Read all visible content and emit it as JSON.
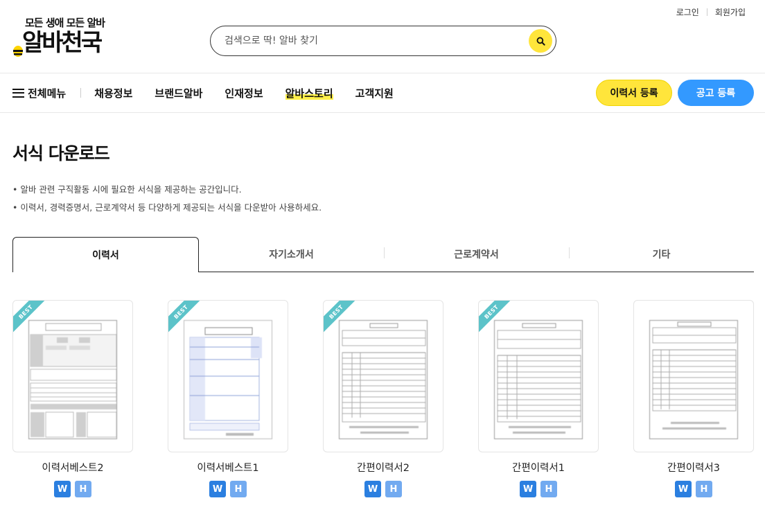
{
  "header": {
    "links": {
      "login": "로그인",
      "signup": "회원가입"
    },
    "logo": {
      "slogan": "모든 생애 모든 알바",
      "name": "알바천국"
    },
    "search": {
      "placeholder": "검색으로 딱! 알바 찾기"
    }
  },
  "nav": {
    "menu_label": "전체메뉴",
    "items": [
      "채용정보",
      "브랜드알바",
      "인재정보",
      "알바스토리",
      "고객지원"
    ],
    "resume_button": "이력서 등록",
    "job_button": "공고 등록"
  },
  "page": {
    "title": "서식 다운로드",
    "desc": [
      "• 알바 관련 구직활동 시에 필요한 서식을 제공하는 공간입니다.",
      "• 이력서, 경력증명서, 근로계약서 등 다양하게 제공되는 서식을 다운받아 사용하세요."
    ]
  },
  "tabs": [
    "이력서",
    "자기소개서",
    "근로계약서",
    "기타"
  ],
  "cards": [
    {
      "title": "이력서베스트2",
      "badge": "BEST",
      "w": "W",
      "h": "H"
    },
    {
      "title": "이력서베스트1",
      "badge": "BEST",
      "w": "W",
      "h": "H"
    },
    {
      "title": "간편이력서2",
      "badge": "BEST",
      "w": "W",
      "h": "H"
    },
    {
      "title": "간편이력서1",
      "badge": "BEST",
      "w": "W",
      "h": "H"
    },
    {
      "title": "간편이력서3",
      "badge": "",
      "w": "W",
      "h": "H"
    }
  ],
  "colors": {
    "accent_yellow": "#ffe53b",
    "accent_blue": "#3399ff",
    "ribbon": "#5cc3c9",
    "word": "#2b7fe0",
    "hwp": "#72aaf0"
  }
}
